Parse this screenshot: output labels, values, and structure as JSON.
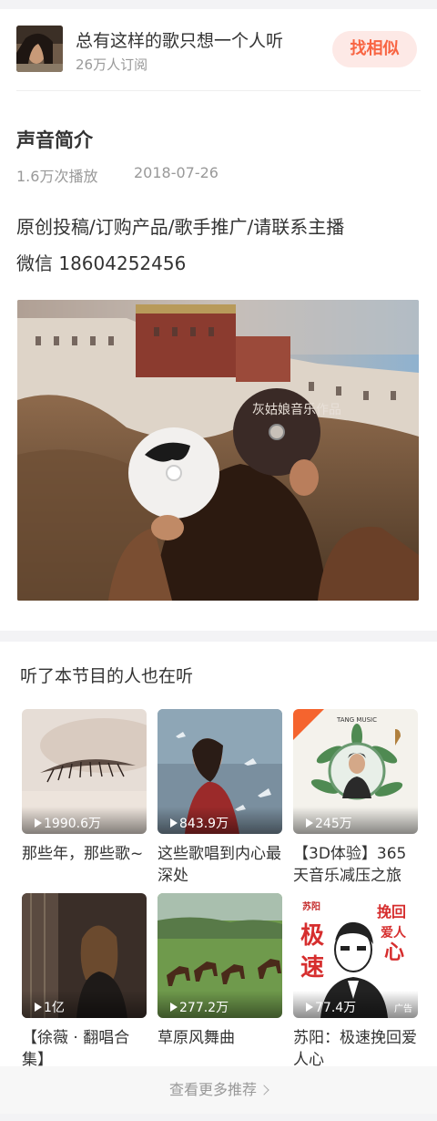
{
  "album": {
    "title": "总有这样的歌只想一个人听",
    "subscribers": "26万人订阅",
    "similar_button": "找相似"
  },
  "intro": {
    "heading": "声音简介",
    "plays": "1.6万次播放",
    "date": "2018-07-26",
    "lines": [
      "原创投稿/订购产品/歌手推广/请联系主播",
      "微信 18604252456"
    ],
    "image_text": {
      "disc_title": "灰姑娘音乐作品"
    }
  },
  "recommend": {
    "heading": "听了本节目的人也在听",
    "cards": [
      {
        "title": "那些年，那些歌~",
        "plays": "1990.6万"
      },
      {
        "title": "这些歌唱到内心最深处",
        "plays": "843.9万"
      },
      {
        "title": "【3D体验】365天音乐减压之旅",
        "plays": "245万",
        "cover_text": "TANG MUSIC"
      },
      {
        "title": "【徐薇 · 翻唱合集】",
        "plays": "1亿"
      },
      {
        "title": "草原风舞曲",
        "plays": "277.2万"
      },
      {
        "title": "苏阳：极速挽回爱人心",
        "plays": "77.4万",
        "ad": "广告",
        "cover_text": {
          "tag": "苏阳",
          "a": "极",
          "b": "速",
          "c": "挽回",
          "d": "爱人",
          "e": "心"
        }
      }
    ],
    "more_label": "查看更多推荐"
  },
  "colors": {
    "accent": "#f86442",
    "accent_bg": "#fde9e6",
    "muted": "#999999"
  }
}
